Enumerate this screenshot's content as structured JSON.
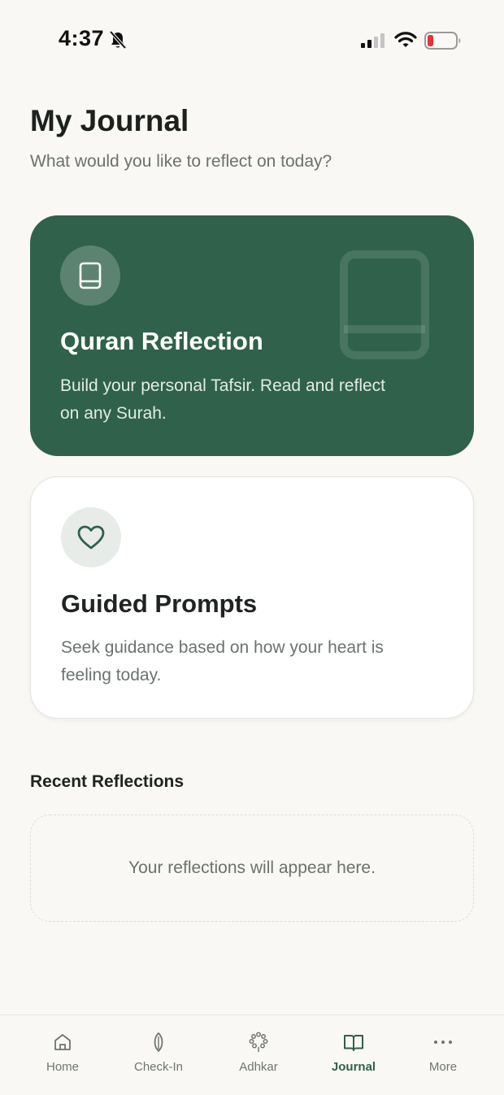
{
  "status": {
    "time": "4:37"
  },
  "header": {
    "title": "My Journal",
    "subtitle": "What would you like to reflect on today?"
  },
  "cards": {
    "quran": {
      "title": "Quran Reflection",
      "description": "Build your personal Tafsir. Read and reflect on any Surah.",
      "icon": "book-icon",
      "color": "#2f614b"
    },
    "guided": {
      "title": "Guided Prompts",
      "description": "Seek guidance based on how your heart is feeling today.",
      "icon": "heart-icon"
    }
  },
  "recent": {
    "title": "Recent Reflections",
    "empty_text": "Your reflections will appear here."
  },
  "tabs": [
    {
      "label": "Home",
      "icon": "home-icon"
    },
    {
      "label": "Check-In",
      "icon": "leaf-icon"
    },
    {
      "label": "Adhkar",
      "icon": "prayer-beads-icon"
    },
    {
      "label": "Journal",
      "icon": "open-book-icon",
      "active": true
    },
    {
      "label": "More",
      "icon": "more-icon"
    }
  ],
  "colors": {
    "accent": "#2f614b",
    "background": "#f9f8f5",
    "muted_text": "#6b726e"
  }
}
